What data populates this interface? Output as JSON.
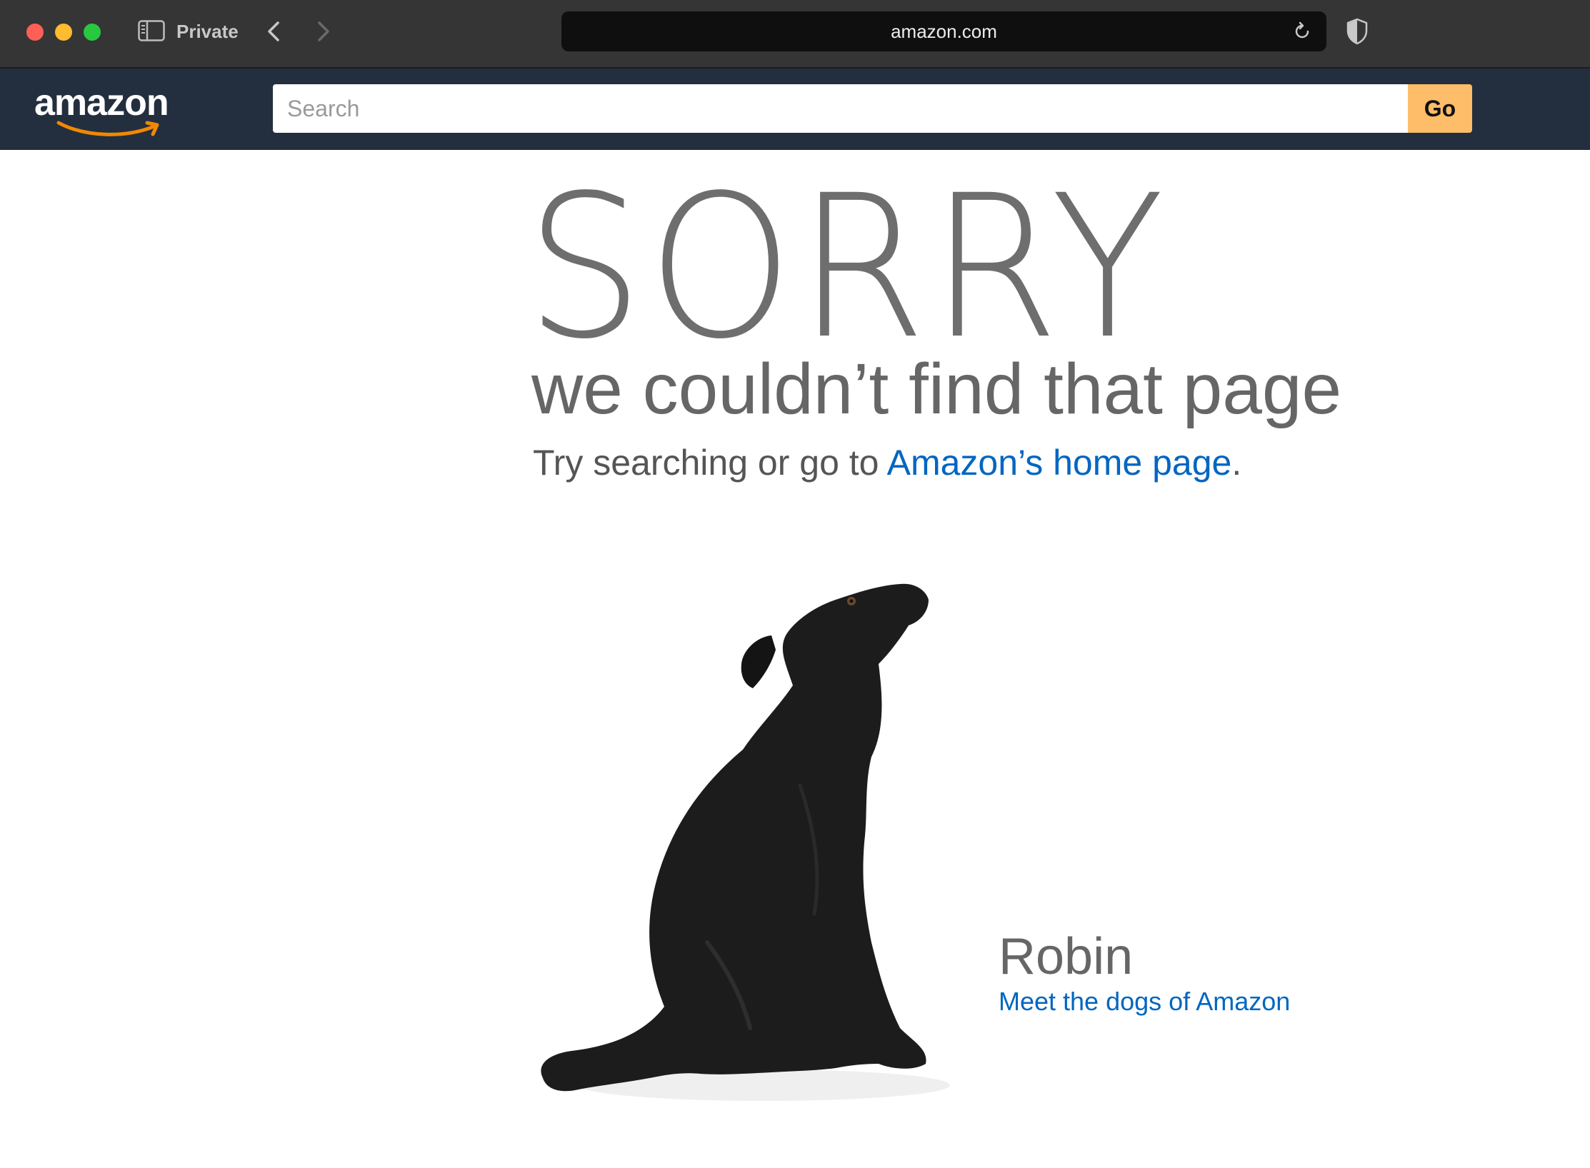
{
  "browser": {
    "private_label": "Private",
    "address": "amazon.com"
  },
  "header": {
    "logo_text": "amazon",
    "search_placeholder": "Search",
    "go_label": "Go",
    "accent_color": "#febd69",
    "background_color": "#232f3e"
  },
  "main": {
    "sorry": "SORRY",
    "subheading": "we couldn’t find that page",
    "try_prefix": "Try searching or go to ",
    "home_link": "Amazon’s home page",
    "try_suffix": ".",
    "link_color": "#0066c0"
  },
  "dog": {
    "name": "Robin",
    "link": "Meet the dogs of Amazon"
  },
  "icons": {
    "sidebar": "sidebar-icon",
    "back": "chevron-left-icon",
    "forward": "chevron-right-icon",
    "reload": "reload-icon",
    "shield": "shield-icon"
  }
}
